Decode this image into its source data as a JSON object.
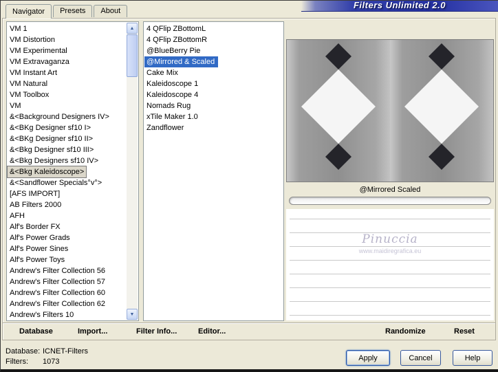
{
  "window": {
    "title": "Filters Unlimited 2.0"
  },
  "tabs": [
    {
      "label": "Navigator",
      "active": true
    },
    {
      "label": "Presets",
      "active": false
    },
    {
      "label": "About",
      "active": false
    }
  ],
  "icons": {
    "scroll_up": "▲",
    "scroll_down": "▼"
  },
  "categories": {
    "selected": "&<Bkg Kaleidoscope>",
    "items": [
      "VM 1",
      "VM Distortion",
      "VM Experimental",
      "VM Extravaganza",
      "VM Instant Art",
      "VM Natural",
      "VM Toolbox",
      "VM",
      "&<Background Designers IV>",
      "&<BKg Designer sf10 I>",
      "&<BKg Designer sf10 II>",
      "&<Bkg Designer sf10 III>",
      "&<Bkg Designers sf10 IV>",
      "&<Bkg Kaleidoscope>",
      "&<Sandflower Specials°v°>",
      "[AFS IMPORT]",
      "AB Filters 2000",
      "AFH",
      "Alf's Border FX",
      "Alf's Power Grads",
      "Alf's Power Sines",
      "Alf's Power Toys",
      "Andrew's Filter Collection 56",
      "Andrew's Filter Collection 57",
      "Andrew's Filter Collection 60",
      "Andrew's Filter Collection 62",
      "Andrew's Filters 10"
    ]
  },
  "filters": {
    "selected": "@Mirrored & Scaled",
    "items": [
      "4 QFlip ZBottomL",
      "4 QFlip ZBottomR",
      "@BlueBerry Pie",
      "@Mirrored & Scaled",
      "Cake Mix",
      "Kaleidoscope 1",
      "Kaleidoscope 4",
      "Nomads Rug",
      "xTile Maker 1.0",
      "Zandflower"
    ]
  },
  "preview": {
    "caption": "@Mirrored Scaled",
    "watermark_line1": "Pinuccia",
    "watermark_line2": "www.maidiregrafica.eu"
  },
  "toolbar": {
    "database": "Database",
    "import": "Import...",
    "filter_info": "Filter Info...",
    "editor": "Editor...",
    "randomize": "Randomize",
    "reset": "Reset"
  },
  "status": {
    "database_label": "Database:",
    "database_value": "ICNET-Filters",
    "filters_label": "Filters:",
    "filters_value": "1073"
  },
  "buttons": {
    "apply": "Apply",
    "cancel": "Cancel",
    "help": "Help"
  },
  "colors": {
    "selection_blue": "#316ac5",
    "banner_blue": "#2a36a4",
    "dialog_bg": "#ece9d8",
    "preview_dark_diamond": "#24242a",
    "preview_light_diamond": "#f5f5f5"
  }
}
